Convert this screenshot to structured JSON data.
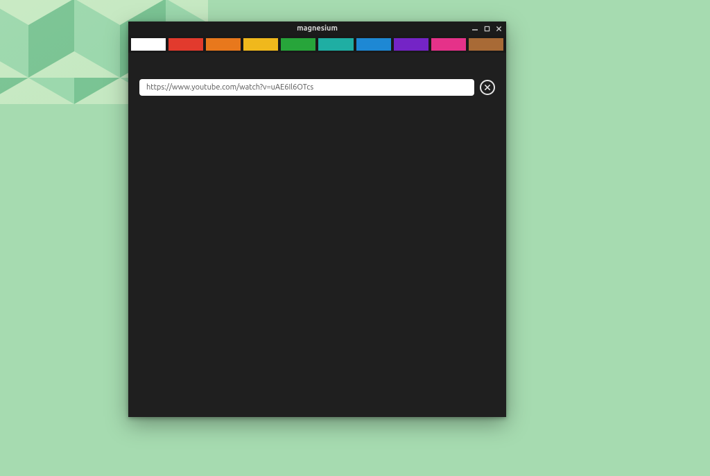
{
  "window": {
    "title": "magnesium"
  },
  "tabs": [
    {
      "color": "#FFFFFF",
      "active": true
    },
    {
      "color": "#E23A2D",
      "active": false
    },
    {
      "color": "#E8781C",
      "active": false
    },
    {
      "color": "#F0B81C",
      "active": false
    },
    {
      "color": "#27A53A",
      "active": false
    },
    {
      "color": "#1FAEA3",
      "active": false
    },
    {
      "color": "#1E88D4",
      "active": false
    },
    {
      "color": "#7424C6",
      "active": false
    },
    {
      "color": "#E53289",
      "active": false
    },
    {
      "color": "#A86A36",
      "active": false
    }
  ],
  "address": {
    "value": "https://www.youtube.com/watch?v=uAE6Il6OTcs"
  },
  "titlebar_controls": {
    "minimize": "minimize",
    "maximize": "maximize",
    "close": "close"
  }
}
